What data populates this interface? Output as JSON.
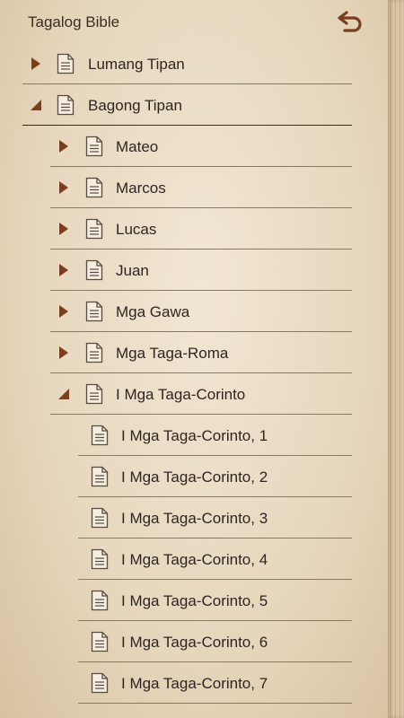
{
  "app": {
    "title": "Tagalog Bible",
    "back_icon": "undo-arrow-icon",
    "accent_color": "#7a3e1e"
  },
  "tree": [
    {
      "label": "Lumang Tipan",
      "level": 0,
      "expanded": false
    },
    {
      "label": "Bagong Tipan",
      "level": 0,
      "expanded": true
    },
    {
      "label": "Mateo",
      "level": 1,
      "expanded": false
    },
    {
      "label": "Marcos",
      "level": 1,
      "expanded": false
    },
    {
      "label": "Lucas",
      "level": 1,
      "expanded": false
    },
    {
      "label": "Juan",
      "level": 1,
      "expanded": false
    },
    {
      "label": "Mga Gawa",
      "level": 1,
      "expanded": false
    },
    {
      "label": "Mga Taga-Roma",
      "level": 1,
      "expanded": false
    },
    {
      "label": "I Mga Taga-Corinto",
      "level": 1,
      "expanded": true
    },
    {
      "label": "I Mga Taga-Corinto, 1",
      "level": 2
    },
    {
      "label": "I Mga Taga-Corinto, 2",
      "level": 2
    },
    {
      "label": "I Mga Taga-Corinto, 3",
      "level": 2
    },
    {
      "label": "I Mga Taga-Corinto, 4",
      "level": 2
    },
    {
      "label": "I Mga Taga-Corinto, 5",
      "level": 2
    },
    {
      "label": "I Mga Taga-Corinto, 6",
      "level": 2
    },
    {
      "label": "I Mga Taga-Corinto, 7",
      "level": 2
    }
  ]
}
